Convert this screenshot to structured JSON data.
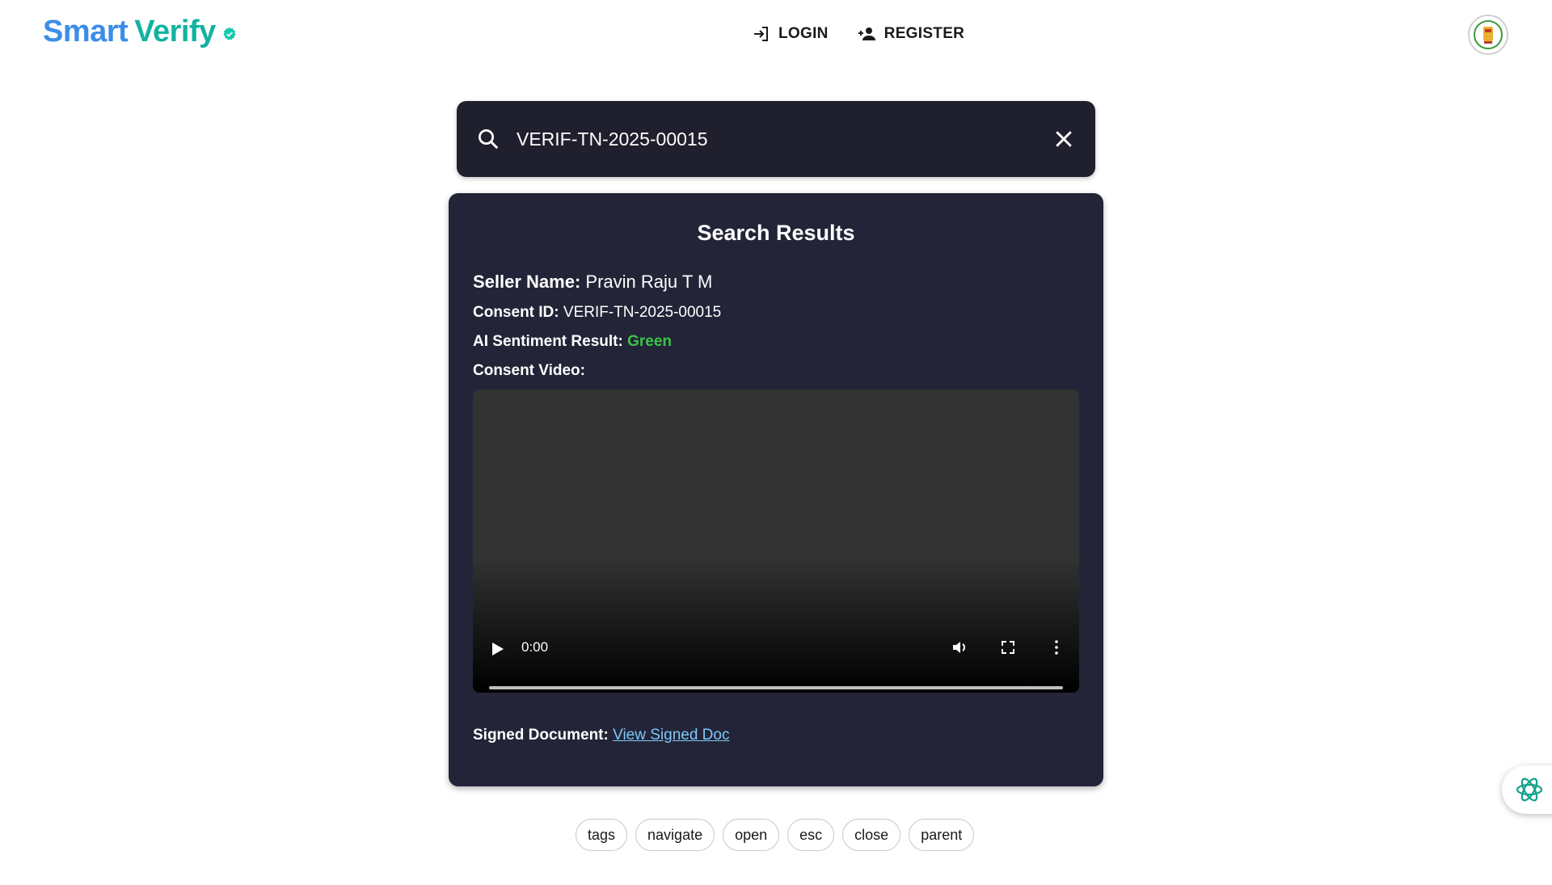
{
  "header": {
    "brand_smart": "Smart",
    "brand_verify": "Verify",
    "nav": [
      {
        "label": "LOGIN",
        "icon": "login-icon"
      },
      {
        "label": "REGISTER",
        "icon": "person-add-icon"
      }
    ],
    "emblem_icon": "state-emblem-icon"
  },
  "search": {
    "value": "VERIF-TN-2025-00015"
  },
  "results": {
    "title": "Search Results",
    "seller_label": "Seller Name:",
    "seller_value": "Pravin Raju T M",
    "consent_label": "Consent ID:",
    "consent_value": "VERIF-TN-2025-00015",
    "sentiment_label": "AI Sentiment Result:",
    "sentiment_value": "Green",
    "video_label": "Consent Video:",
    "video_time": "0:00",
    "doc_label": "Signed Document:",
    "doc_link": "View Signed Doc"
  },
  "chips": [
    "tags",
    "navigate",
    "open",
    "esc",
    "close",
    "parent"
  ],
  "colors": {
    "brand_blue": "#3b8ee8",
    "brand_teal": "#12b3a0",
    "card_bg": "#232437",
    "search_bg": "#1f1f2d",
    "sentiment_green": "#3cc24a",
    "link": "#7ec8f8"
  }
}
